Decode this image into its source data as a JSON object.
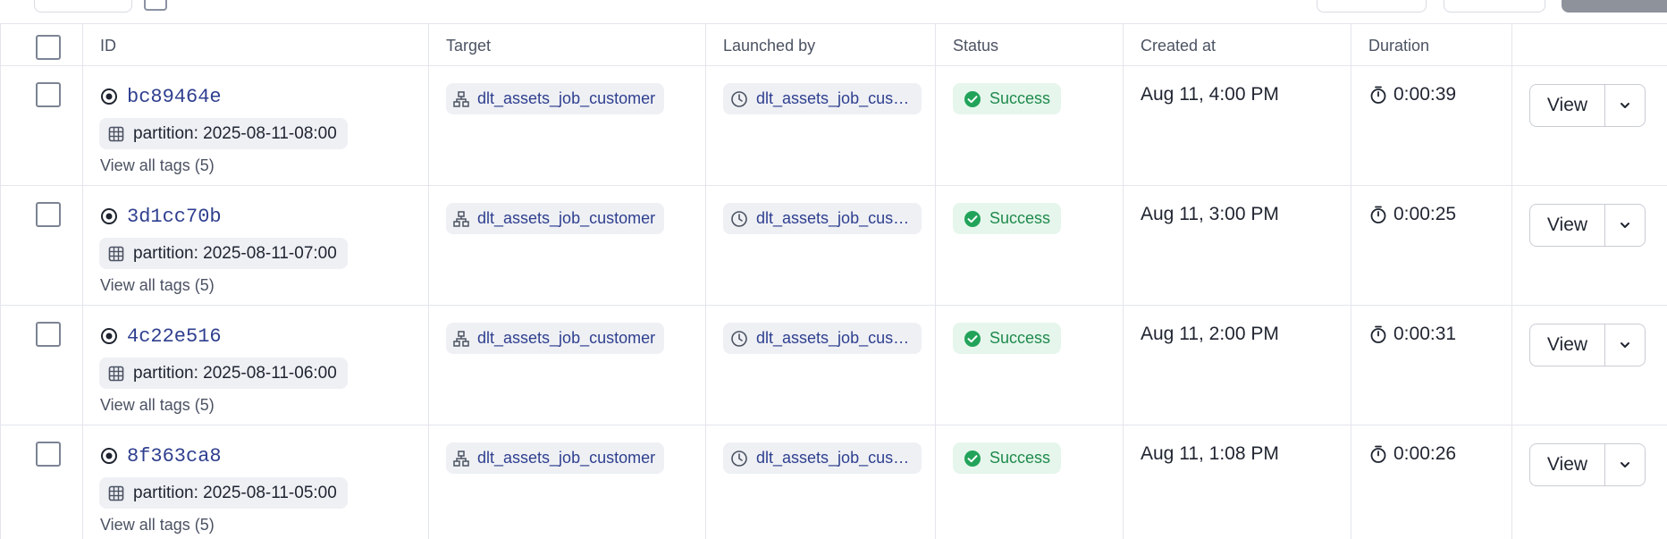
{
  "table": {
    "headers": {
      "id": "ID",
      "target": "Target",
      "launched_by": "Launched by",
      "status": "Status",
      "created_at": "Created at",
      "duration": "Duration"
    },
    "rows": [
      {
        "id": "bc89464e",
        "partition": "partition: 2025-08-11-08:00",
        "view_all_tags": "View all tags (5)",
        "target": "dlt_assets_job_customer",
        "launched_by": "dlt_assets_job_customer",
        "status": "Success",
        "created_at": "Aug 11, 4:00 PM",
        "duration": "0:00:39",
        "view_label": "View"
      },
      {
        "id": "3d1cc70b",
        "partition": "partition: 2025-08-11-07:00",
        "view_all_tags": "View all tags (5)",
        "target": "dlt_assets_job_customer",
        "launched_by": "dlt_assets_job_customer",
        "status": "Success",
        "created_at": "Aug 11, 3:00 PM",
        "duration": "0:00:25",
        "view_label": "View"
      },
      {
        "id": "4c22e516",
        "partition": "partition: 2025-08-11-06:00",
        "view_all_tags": "View all tags (5)",
        "target": "dlt_assets_job_customer",
        "launched_by": "dlt_assets_job_customer",
        "status": "Success",
        "created_at": "Aug 11, 2:00 PM",
        "duration": "0:00:31",
        "view_label": "View"
      },
      {
        "id": "8f363ca8",
        "partition": "partition: 2025-08-11-05:00",
        "view_all_tags": "View all tags (5)",
        "target": "dlt_assets_job_customer",
        "launched_by": "dlt_assets_job_customer",
        "status": "Success",
        "created_at": "Aug 11, 1:08 PM",
        "duration": "0:00:26",
        "view_label": "View"
      }
    ]
  },
  "colors": {
    "link": "#2f3f8f",
    "success_bg": "#e6f6ec",
    "success_text": "#1f8a4c",
    "chip_bg": "#eef0f4",
    "border": "#e3e6ec"
  },
  "icons": {
    "run": "run-target-icon",
    "partition": "calendar-grid-icon",
    "target": "asset-graph-icon",
    "launched_by": "schedule-clock-icon",
    "status": "check-circle-icon",
    "duration": "stopwatch-icon",
    "more": "chevron-down-icon"
  }
}
